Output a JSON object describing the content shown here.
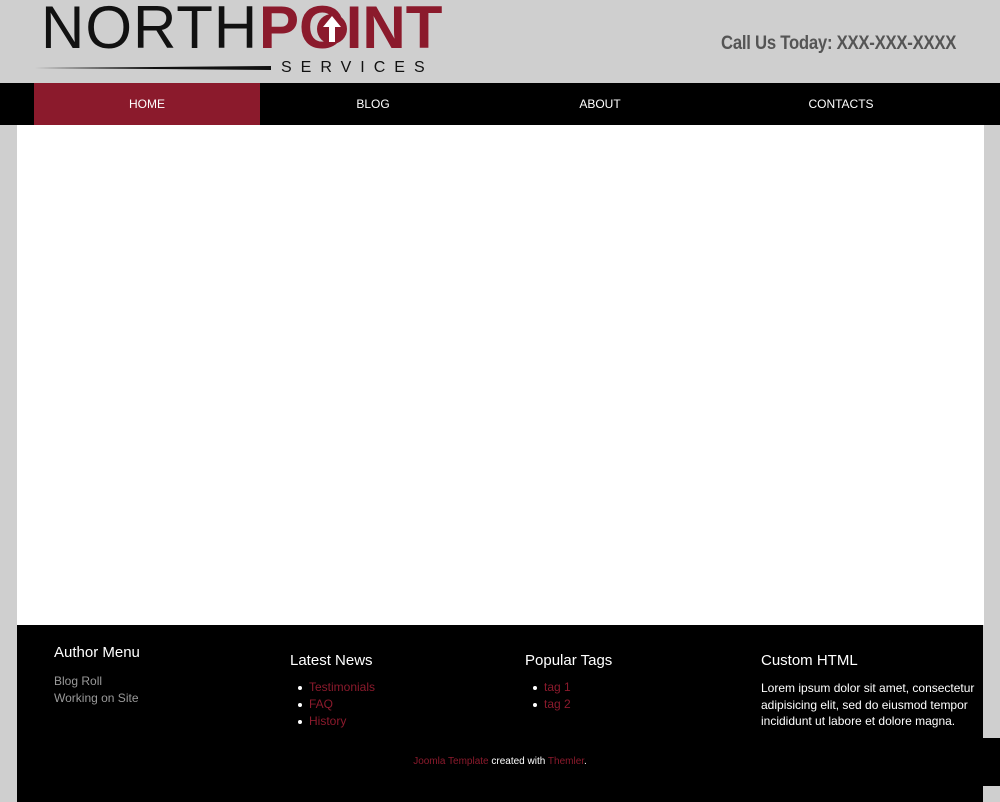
{
  "header": {
    "logo": {
      "north": "NORTH",
      "point": "POINT",
      "services": "SERVICES"
    },
    "phone": "Call Us Today: XXX-XXX-XXXX"
  },
  "nav": {
    "items": [
      {
        "label": "HOME",
        "active": true
      },
      {
        "label": "BLOG",
        "active": false
      },
      {
        "label": "ABOUT",
        "active": false
      },
      {
        "label": "CONTACTS",
        "active": false
      }
    ]
  },
  "footer": {
    "author_menu": {
      "title": "Author Menu",
      "links": [
        "Blog Roll",
        "Working on Site"
      ]
    },
    "latest_news": {
      "title": "Latest News",
      "items": [
        "Testimonials",
        "FAQ",
        "History"
      ]
    },
    "popular_tags": {
      "title": "Popular Tags",
      "items": [
        "tag 1",
        "tag 2"
      ]
    },
    "custom_html": {
      "title": "Custom HTML",
      "text": "Lorem ipsum dolor sit amet, consectetur adipisicing elit, sed do eiusmod tempor incididunt ut labore et dolore magna."
    },
    "credit": {
      "link1": "Joomla Template",
      "middle": " created with ",
      "link2": "Themler",
      "end": "."
    }
  },
  "colors": {
    "accent": "#8b1a2c",
    "nav_bg": "#000000",
    "page_bg": "#cfcfcf",
    "phone_text": "#555555"
  }
}
